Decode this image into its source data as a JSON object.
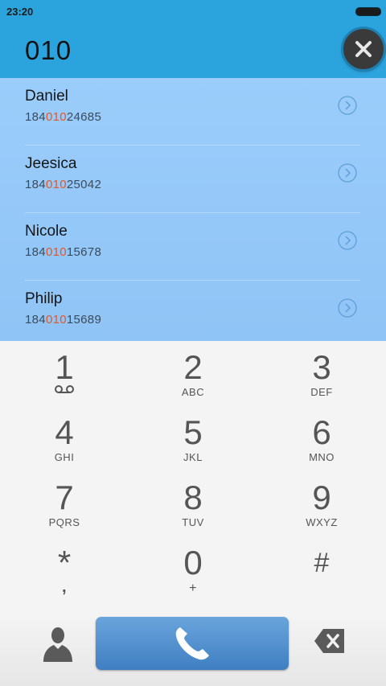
{
  "status_bar": {
    "time": "23:20"
  },
  "dial": {
    "entered_number": "010"
  },
  "contacts": [
    {
      "name": "Daniel",
      "phone_prefix": "184",
      "phone_match": "010",
      "phone_suffix": "24685"
    },
    {
      "name": "Jeesica",
      "phone_prefix": "184",
      "phone_match": "010",
      "phone_suffix": "25042"
    },
    {
      "name": "Nicole",
      "phone_prefix": "184",
      "phone_match": "010",
      "phone_suffix": "15678"
    },
    {
      "name": "Philip",
      "phone_prefix": "184",
      "phone_match": "010",
      "phone_suffix": "15689"
    }
  ],
  "keys": [
    {
      "digit": "1",
      "letters": ""
    },
    {
      "digit": "2",
      "letters": "ABC"
    },
    {
      "digit": "3",
      "letters": "DEF"
    },
    {
      "digit": "4",
      "letters": "GHI"
    },
    {
      "digit": "5",
      "letters": "JKL"
    },
    {
      "digit": "6",
      "letters": "MNO"
    },
    {
      "digit": "7",
      "letters": "PQRS"
    },
    {
      "digit": "8",
      "letters": "TUV"
    },
    {
      "digit": "9",
      "letters": "WXYZ"
    },
    {
      "digit": "*",
      "letters": ","
    },
    {
      "digit": "0",
      "letters": "+"
    },
    {
      "digit": "#",
      "letters": ""
    }
  ],
  "icons": {
    "clear": "close-icon",
    "voicemail": "voicemail-icon",
    "chevron": "chevron-right-circle-icon",
    "contacts": "person-icon",
    "call": "phone-icon",
    "backspace": "backspace-icon"
  },
  "colors": {
    "header": "#2ba4de",
    "list_background": "#9bcdfb",
    "match_highlight": "#e2572a",
    "call_button": "#4f8fd0"
  }
}
